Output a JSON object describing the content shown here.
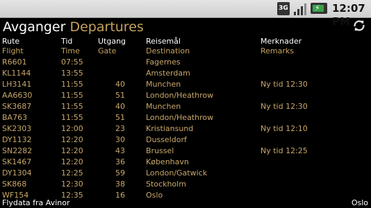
{
  "statusbar": {
    "network": "3G",
    "time": "12:07 PM",
    "signal_level": 0.75
  },
  "header": {
    "title_no": "Avganger",
    "title_en": "Departures"
  },
  "columns": {
    "flight": {
      "no": "Rute",
      "en": "Flight"
    },
    "time": {
      "no": "Tid",
      "en": "Time"
    },
    "gate": {
      "no": "Utgang",
      "en": "Gate"
    },
    "dest": {
      "no": "Reisemål",
      "en": "Destination"
    },
    "remarks": {
      "no": "Merknader",
      "en": "Remarks"
    }
  },
  "flights": [
    {
      "flight": "R6601",
      "time": "07:55",
      "gate": "",
      "dest": "Fagernes",
      "remarks": ""
    },
    {
      "flight": "KL1144",
      "time": "13:55",
      "gate": "",
      "dest": "Amsterdam",
      "remarks": ""
    },
    {
      "flight": "LH3141",
      "time": "11:55",
      "gate": "40",
      "dest": "Munchen",
      "remarks": "Ny tid 12:30"
    },
    {
      "flight": "AA6630",
      "time": "11:55",
      "gate": "51",
      "dest": "London/Heathrow",
      "remarks": ""
    },
    {
      "flight": "SK3687",
      "time": "11:55",
      "gate": "40",
      "dest": "Munchen",
      "remarks": "Ny tid 12:30"
    },
    {
      "flight": "BA763",
      "time": "11:55",
      "gate": "51",
      "dest": "London/Heathrow",
      "remarks": ""
    },
    {
      "flight": "SK2303",
      "time": "12:00",
      "gate": "23",
      "dest": "Kristiansund",
      "remarks": "Ny tid 12:10"
    },
    {
      "flight": "DY1132",
      "time": "12:20",
      "gate": "30",
      "dest": "Dusseldorf",
      "remarks": ""
    },
    {
      "flight": "SN2282",
      "time": "12:20",
      "gate": "43",
      "dest": "Brussel",
      "remarks": "Ny tid 12:25"
    },
    {
      "flight": "SK1467",
      "time": "12:20",
      "gate": "36",
      "dest": "København",
      "remarks": ""
    },
    {
      "flight": "DY1304",
      "time": "12:25",
      "gate": "59",
      "dest": "London/Gatwick",
      "remarks": ""
    },
    {
      "flight": "SK868",
      "time": "12:30",
      "gate": "38",
      "dest": "Stockholm",
      "remarks": ""
    },
    {
      "flight": "WF154",
      "time": "12:35",
      "gate": "16",
      "dest": "Oslo",
      "remarks": ""
    }
  ],
  "footer": {
    "source": "Flydata fra Avinor",
    "airport": "Oslo"
  },
  "colors": {
    "accent": "#c6a25e",
    "background": "#000000"
  }
}
